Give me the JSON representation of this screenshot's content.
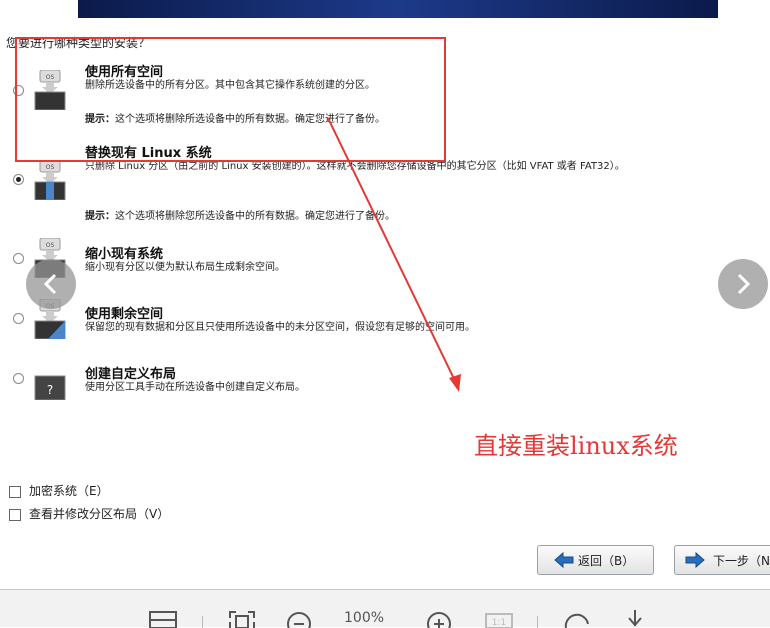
{
  "question": "您要进行哪种类型的安装？",
  "options": [
    {
      "title": "使用所有空间",
      "desc": "删除所选设备中的所有分区。其中包含其它操作系统创建的分区。",
      "tip_label": "提示：",
      "tip": "这个选项将删除所选设备中的所有数据。确定您进行了备份。",
      "selected": false,
      "icon_tag": "OS"
    },
    {
      "title": "替换现有 Linux 系统",
      "desc": "只删除 Linux 分区（由之前的 Linux 安装创建的）。这样就不会删除您存储设备中的其它分区（比如 VFAT 或者 FAT32）。",
      "tip_label": "提示：",
      "tip": "这个选项将删除您所选设备中的所有数据。确定您进行了备份。",
      "selected": true,
      "icon_tag": "OS"
    },
    {
      "title": "缩小现有系统",
      "desc": "缩小现有分区以便为默认布局生成剩余空间。",
      "selected": false,
      "icon_tag": "OS"
    },
    {
      "title": "使用剩余空间",
      "desc": "保留您的现有数据和分区且只使用所选设备中的未分区空间，假设您有足够的空间可用。",
      "selected": false,
      "icon_tag": "OS"
    },
    {
      "title": "创建自定义布局",
      "desc": "使用分区工具手动在所选设备中创建自定义布局。",
      "selected": false,
      "icon_tag": "?"
    }
  ],
  "checkboxes": [
    {
      "label": "加密系统（E）",
      "checked": false
    },
    {
      "label": "查看并修改分区布局（V）",
      "checked": false
    }
  ],
  "buttons": {
    "back": "返回（B）",
    "next": "下一步（N"
  },
  "footer": {
    "zoom": "100%"
  },
  "annotation": "直接重装linux系统",
  "colors": {
    "annotation_red": "#e53935",
    "radio_selected": "#222222"
  }
}
